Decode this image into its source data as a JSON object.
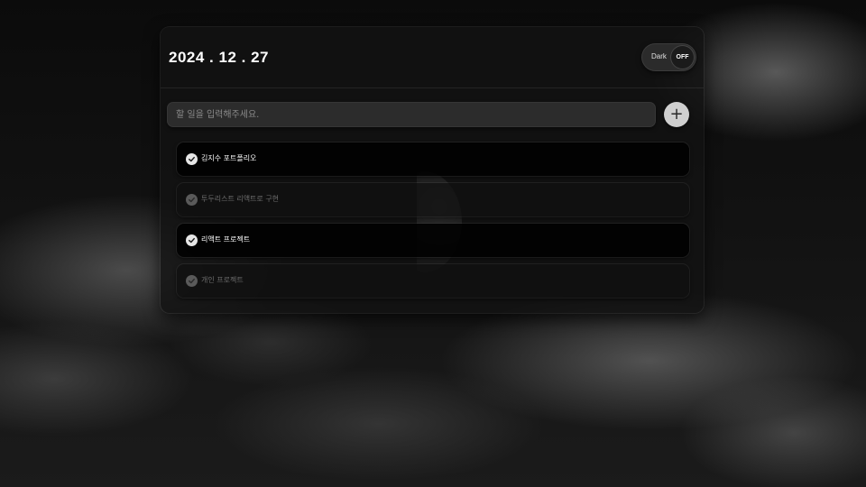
{
  "header": {
    "date": "2024 . 12 . 27"
  },
  "theme_toggle": {
    "label": "Dark",
    "state": "OFF"
  },
  "new_todo": {
    "placeholder": "할 일을 입력해주세요.",
    "add_symbol": "+"
  },
  "todos": [
    {
      "text": "김지수 포트폴리오",
      "active": true
    },
    {
      "text": "투두리스트 리액트로 구현",
      "active": false
    },
    {
      "text": "리액트 프로젝트",
      "active": true
    },
    {
      "text": "개인 프로젝트",
      "active": false
    }
  ],
  "icons": {
    "check": "check-icon",
    "add": "plus-icon",
    "background": "moon-night-sky"
  },
  "colors": {
    "card_bg": "#121212",
    "item_bg": "#000000",
    "check_active": "#e6e6e6",
    "check_inactive": "#5a5a5a",
    "add_button": "#cfcfcf"
  }
}
